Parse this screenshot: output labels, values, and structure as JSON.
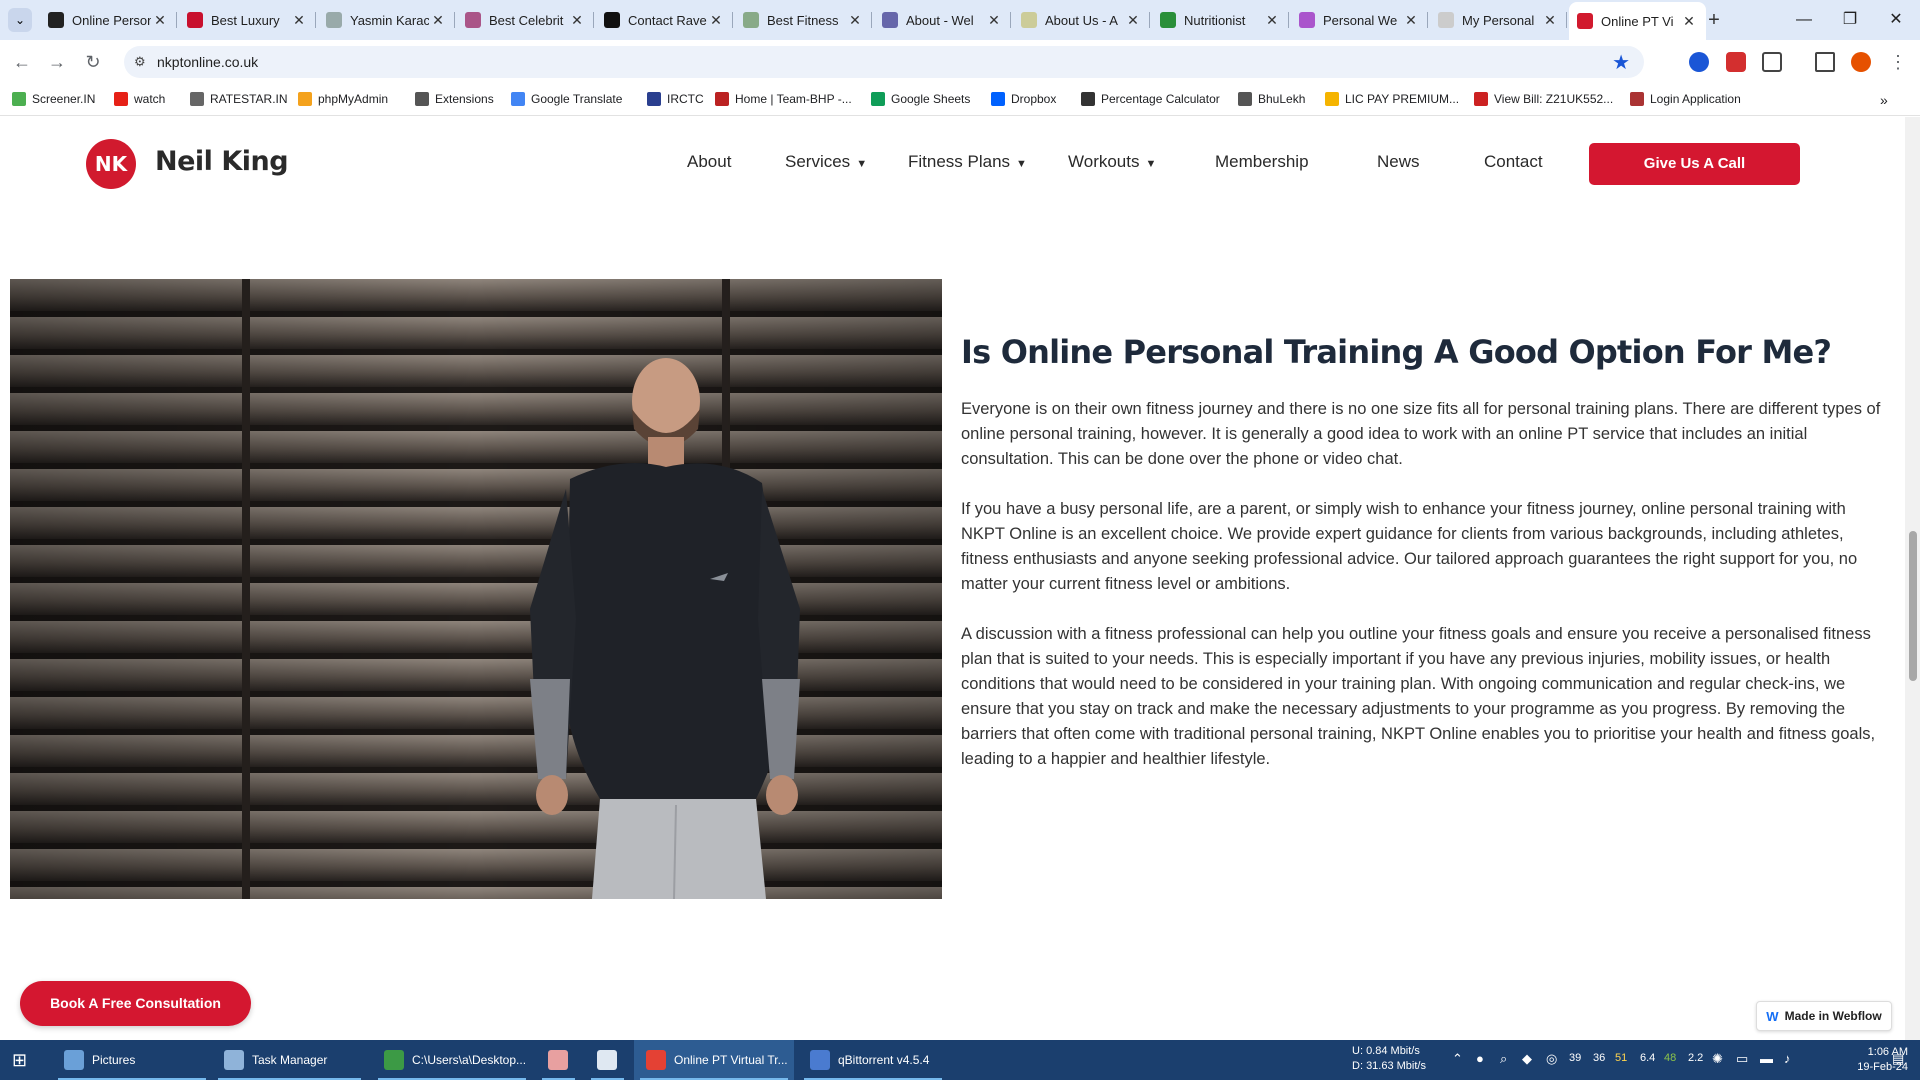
{
  "browser": {
    "tabs": [
      {
        "title": "Online Personal",
        "color": "#222222"
      },
      {
        "title": "Best Luxury",
        "color": "#c8102e"
      },
      {
        "title": "Yasmin Karac",
        "color": "#9aa"
      },
      {
        "title": "Best Celebrit",
        "color": "#a58"
      },
      {
        "title": "Contact Rave",
        "color": "#111111"
      },
      {
        "title": "Best Fitness",
        "color": "#8a8"
      },
      {
        "title": "About - Wel",
        "color": "#66a"
      },
      {
        "title": "About Us - A",
        "color": "#cc9"
      },
      {
        "title": "Nutritionist",
        "color": "#2a8f3a"
      },
      {
        "title": "Personal We",
        "color": "#a5c"
      },
      {
        "title": "My Personal",
        "color": "#ccc"
      },
      {
        "title": "Online PT Vi",
        "color": "#d11a2e"
      }
    ],
    "url": "nkptonline.co.uk",
    "bookmarks": [
      {
        "label": "Screener.IN",
        "color": "#4caf50"
      },
      {
        "label": "watch",
        "color": "#e62117"
      },
      {
        "label": "RATESTAR.IN",
        "color": "#666"
      },
      {
        "label": "phpMyAdmin",
        "color": "#f4a21d"
      },
      {
        "label": "Extensions",
        "color": "#555"
      },
      {
        "label": "Google Translate",
        "color": "#4285f4"
      },
      {
        "label": "IRCTC",
        "color": "#2a3f8f"
      },
      {
        "label": "Home | Team-BHP -...",
        "color": "#b22"
      },
      {
        "label": "Google Sheets",
        "color": "#0f9d58"
      },
      {
        "label": "Dropbox",
        "color": "#0061fe"
      },
      {
        "label": "Percentage Calculator",
        "color": "#333"
      },
      {
        "label": "BhuLekh",
        "color": "#555"
      },
      {
        "label": "LIC PAY PREMIUM...",
        "color": "#f5b400"
      },
      {
        "label": "View Bill: Z21UK552...",
        "color": "#c22"
      },
      {
        "label": "Login Application",
        "color": "#a33"
      }
    ]
  },
  "site": {
    "logo_mark": "NK",
    "logo_text": "Neil King",
    "nav": {
      "about": "About",
      "services": "Services",
      "fitness_plans": "Fitness Plans",
      "workouts": "Workouts",
      "membership": "Membership",
      "news": "News",
      "contact": "Contact",
      "call": "Give Us A Call"
    },
    "heading": "Is Online Personal Training A Good Option For Me?",
    "paragraphs": [
      "Everyone is on their own fitness journey and there is no one size fits all for personal training plans. There are different types of online personal training, however. It is generally a good idea to work with an online PT service that includes an initial consultation. This can be done over the phone or video chat.",
      "If you have a busy personal life, are a parent, or simply wish to enhance your fitness journey, online personal training with NKPT Online is an excellent choice. We provide expert guidance for clients from various backgrounds, including athletes, fitness enthusiasts and anyone seeking professional advice. Our tailored approach guarantees the right support for you, no matter your current fitness level or ambitions.",
      "A discussion with a fitness professional can help you outline your fitness goals and ensure you receive a personalised fitness plan that is suited to your needs. This is especially important if you have any previous injuries, mobility issues, or health conditions that would need to be considered in your training plan. With ongoing communication and regular check-ins, we ensure that you stay on track and make the necessary adjustments to your programme as you progress. By removing the barriers that often come with traditional personal training, NKPT Online enables you to prioritise your health and fitness goals, leading to a happier and healthier lifestyle."
    ],
    "consult_button": "Book A Free Consultation",
    "webflow_badge": "Made in Webflow",
    "brand_color": "#d41730"
  },
  "taskbar": {
    "items": [
      {
        "label": "Pictures"
      },
      {
        "label": "Task Manager"
      },
      {
        "label": "C:\\Users\\a\\Desktop..."
      },
      {
        "label": ""
      },
      {
        "label": ""
      },
      {
        "label": "Online PT Virtual Tr..."
      },
      {
        "label": "qBittorrent v4.5.4"
      }
    ],
    "net_up_label": "U:",
    "net_down_label": "D:",
    "net_up": "0.84 Mbit/s",
    "net_down": "31.63 Mbit/s",
    "tray_numbers": [
      "39",
      "36",
      "51",
      "6.4",
      "48",
      "2.2"
    ],
    "time": "1:06 AM",
    "date": "19-Feb-24"
  }
}
